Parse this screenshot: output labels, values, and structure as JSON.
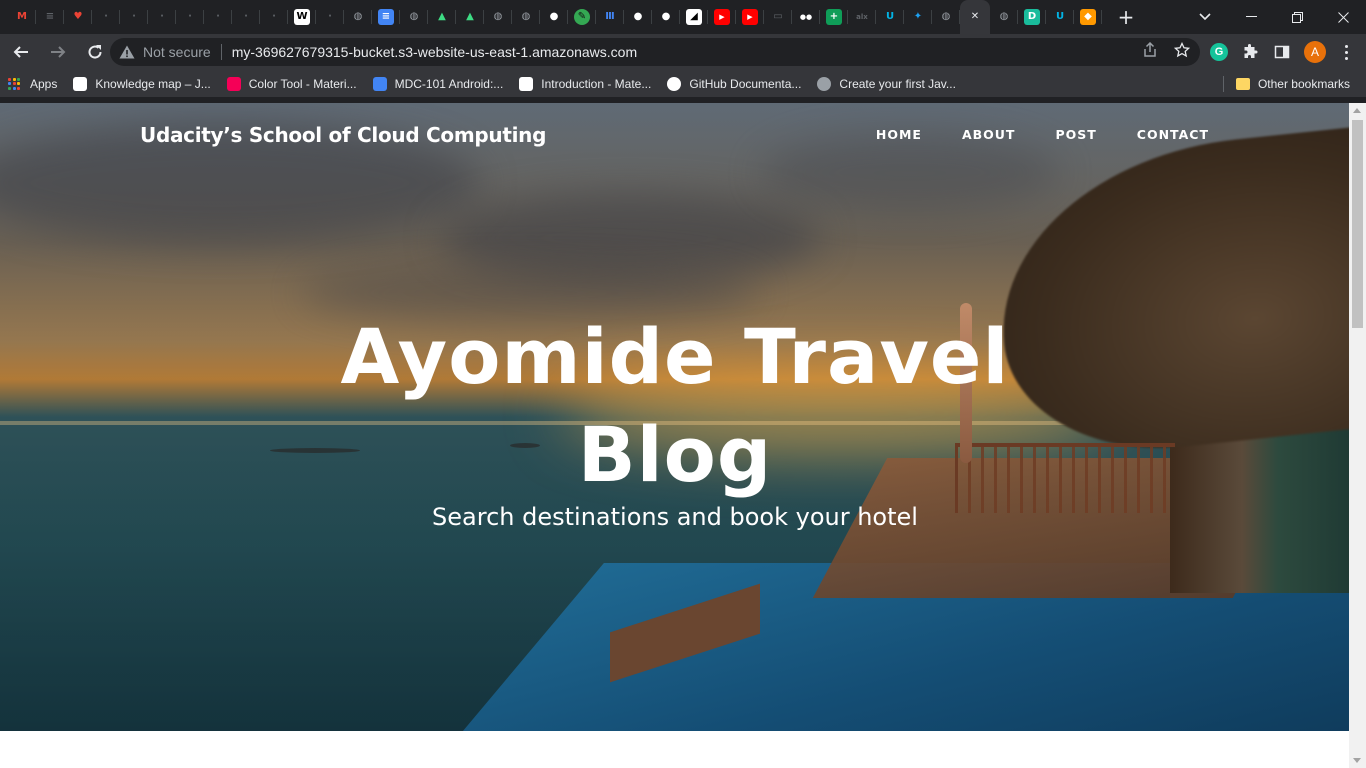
{
  "browser": {
    "tabs": [
      {
        "icon": "gmail-icon",
        "color": "#ea4335",
        "glyph": "M"
      },
      {
        "icon": "tab-generic-icon",
        "color": "#5f6368",
        "glyph": "≡"
      },
      {
        "icon": "heart-icon",
        "color": "#ea4335",
        "glyph": "♥"
      },
      {
        "icon": "tab-generic-icon",
        "color": "#5f6368",
        "glyph": "·"
      },
      {
        "icon": "tab-generic-icon",
        "color": "#5f6368",
        "glyph": "·"
      },
      {
        "icon": "tab-generic-icon",
        "color": "#5f6368",
        "glyph": "·"
      },
      {
        "icon": "tab-generic-icon",
        "color": "#5f6368",
        "glyph": "·"
      },
      {
        "icon": "tab-generic-icon",
        "color": "#5f6368",
        "glyph": "·"
      },
      {
        "icon": "tab-generic-icon",
        "color": "#5f6368",
        "glyph": "·"
      },
      {
        "icon": "tab-generic-icon",
        "color": "#5f6368",
        "glyph": "·"
      },
      {
        "icon": "wikipedia-icon",
        "color": "#ffffff",
        "glyph": "W"
      },
      {
        "icon": "tab-generic-icon",
        "color": "#5f6368",
        "glyph": "·"
      },
      {
        "icon": "globe-icon",
        "color": "#9aa0a6",
        "glyph": "◍"
      },
      {
        "icon": "google-docs-icon",
        "color": "#4285f4",
        "glyph": "≡"
      },
      {
        "icon": "globe-icon",
        "color": "#9aa0a6",
        "glyph": "◍"
      },
      {
        "icon": "android-icon",
        "color": "#3ddc84",
        "glyph": "▲"
      },
      {
        "icon": "android-icon",
        "color": "#3ddc84",
        "glyph": "▲"
      },
      {
        "icon": "globe-icon",
        "color": "#9aa0a6",
        "glyph": "◍"
      },
      {
        "icon": "globe-icon",
        "color": "#9aa0a6",
        "glyph": "◍"
      },
      {
        "icon": "github-icon",
        "color": "#ffffff",
        "glyph": "●"
      },
      {
        "icon": "leaf-icon",
        "color": "#34a853",
        "glyph": "✎"
      },
      {
        "icon": "bank-icon",
        "color": "#4285f4",
        "glyph": "Ⅲ"
      },
      {
        "icon": "github-icon",
        "color": "#ffffff",
        "glyph": "●"
      },
      {
        "icon": "github-icon",
        "color": "#ffffff",
        "glyph": "●"
      },
      {
        "icon": "notion-icon",
        "color": "#ffffff",
        "glyph": "◢"
      },
      {
        "icon": "youtube-icon",
        "color": "#ff0000",
        "glyph": "▶"
      },
      {
        "icon": "youtube-icon",
        "color": "#ff0000",
        "glyph": "▶"
      },
      {
        "icon": "tab-generic-icon",
        "color": "#5f6368",
        "glyph": "▭"
      },
      {
        "icon": "medium-icon",
        "color": "#ffffff",
        "glyph": "●●"
      },
      {
        "icon": "google-sheets-icon",
        "color": "#0f9d58",
        "glyph": "+"
      },
      {
        "icon": "alx-icon",
        "color": "#5f6368",
        "glyph": "alx"
      },
      {
        "icon": "udacity-icon",
        "color": "#02b3e4",
        "glyph": "U"
      },
      {
        "icon": "twitter-icon",
        "color": "#1da1f2",
        "glyph": "✦"
      },
      {
        "icon": "globe-icon",
        "color": "#9aa0a6",
        "glyph": "◍"
      },
      {
        "icon": "close-icon",
        "color": "#e8eaed",
        "glyph": "✕",
        "active": true
      },
      {
        "icon": "globe-icon",
        "color": "#9aa0a6",
        "glyph": "◍"
      },
      {
        "icon": "docs-green-icon",
        "color": "#1abc9c",
        "glyph": "D"
      },
      {
        "icon": "udacity-icon",
        "color": "#02b3e4",
        "glyph": "U"
      },
      {
        "icon": "aws-cube-icon",
        "color": "#f90",
        "glyph": "◆"
      }
    ],
    "address": {
      "security_label": "Not secure",
      "url": "my-369627679315-bucket.s3-website-us-east-1.amazonaws.com"
    },
    "profile_initial": "A",
    "grammarly_glyph": "G",
    "bookmarks": [
      {
        "label": "Apps",
        "icon": "apps-grid-icon"
      },
      {
        "label": "Knowledge map – J...",
        "icon": "notion-icon",
        "color": "#ffffff"
      },
      {
        "label": "Color Tool - Materi...",
        "icon": "material-icon",
        "color": "#f50057"
      },
      {
        "label": "MDC-101 Android:...",
        "icon": "codelabs-icon",
        "color": "#4285f4"
      },
      {
        "label": "Introduction - Mate...",
        "icon": "material-doc-icon",
        "color": "#ffffff"
      },
      {
        "label": "GitHub Documenta...",
        "icon": "github-icon",
        "color": "#ffffff"
      },
      {
        "label": "Create your first Jav...",
        "icon": "globe-icon",
        "color": "#9aa0a6"
      }
    ],
    "other_bookmarks": "Other bookmarks"
  },
  "site": {
    "brand": "Udacity’s School of Cloud Computing",
    "nav": [
      "HOME",
      "ABOUT",
      "POST",
      "CONTACT"
    ],
    "heading_line1": "Ayomide Travel",
    "heading_line2": "Blog",
    "subheading": "Search destinations and book your hotel"
  }
}
